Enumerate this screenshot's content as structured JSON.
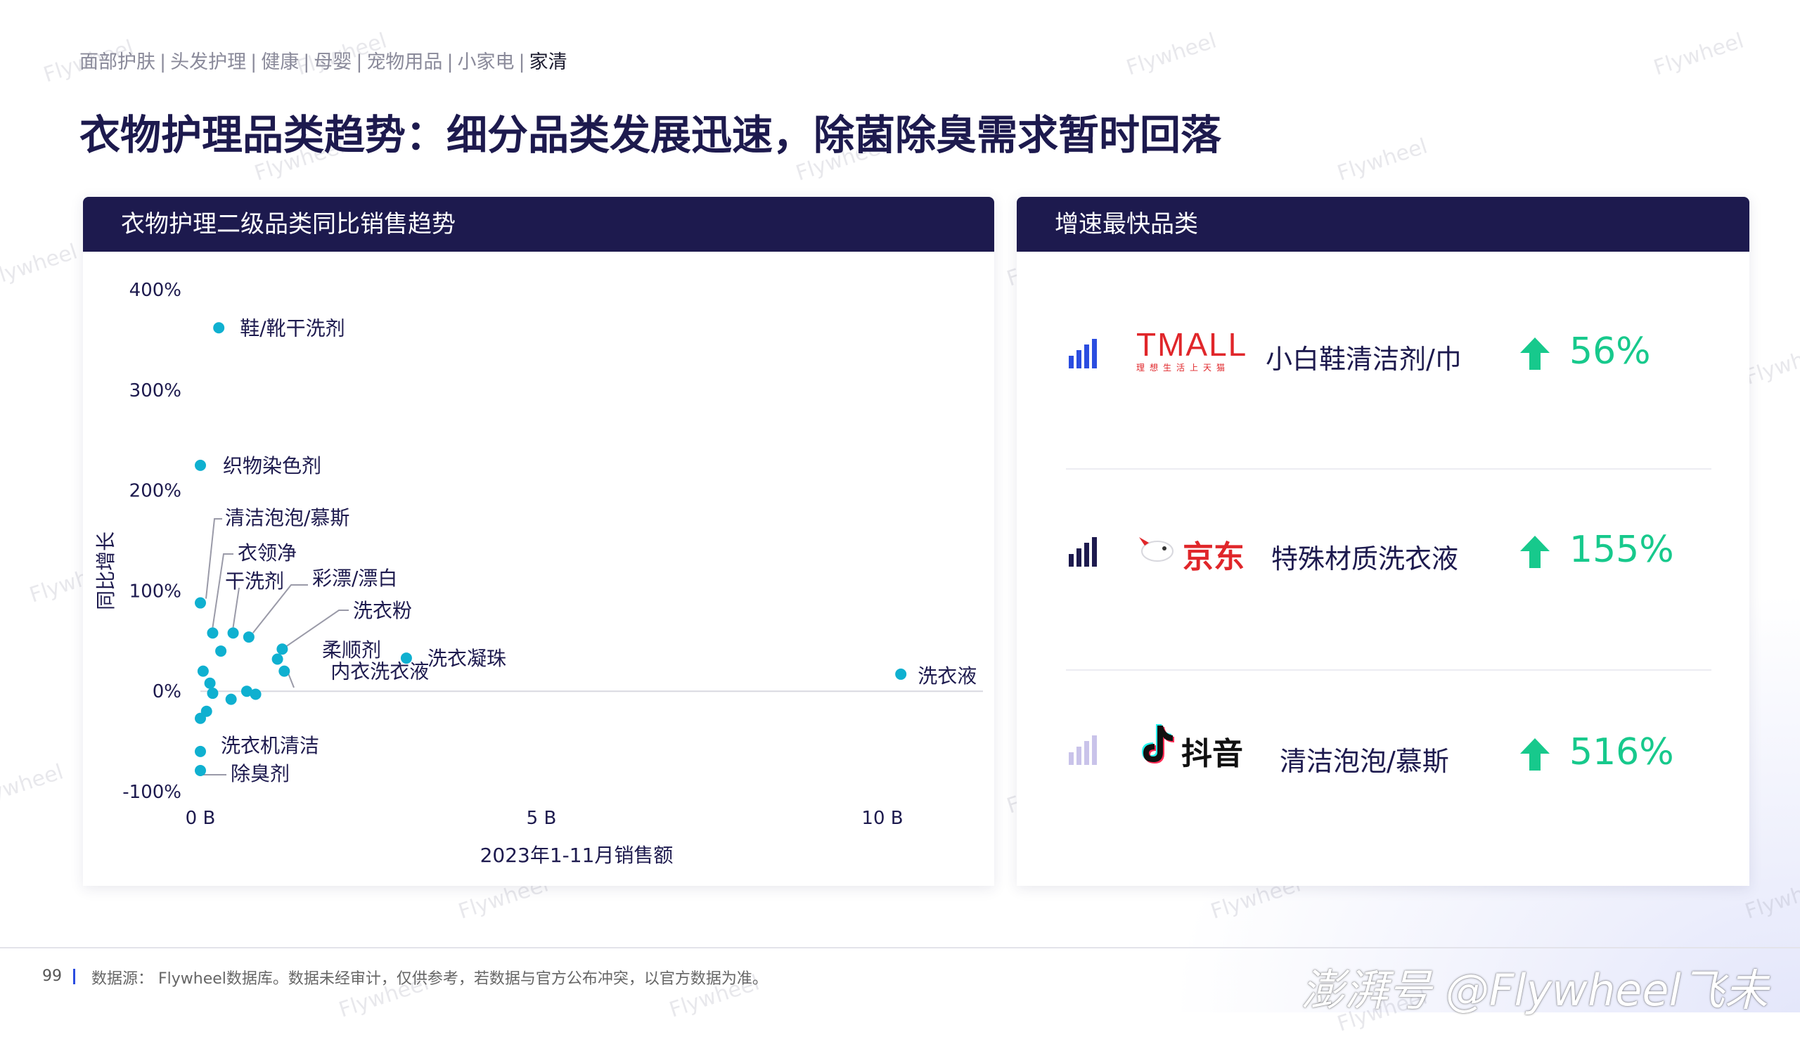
{
  "breadcrumb": {
    "items": [
      "面部护肤",
      "头发护理",
      "健康",
      "母婴",
      "宠物用品",
      "小家电",
      "家清"
    ],
    "separator": "|",
    "active_index": 6
  },
  "page_title": "衣物护理品类趋势：细分品类发展迅速，除菌除臭需求暂时回落",
  "left_panel": {
    "header": "衣物护理二级品类同比销售趋势"
  },
  "right_panel": {
    "header": "增速最快品类",
    "rows": [
      {
        "platform": "TMALL",
        "platform_sub": "理想生活上天猫",
        "category": "小白鞋清洁剂/巾",
        "growth": "56%",
        "bar_color": "#2b4de0"
      },
      {
        "platform": "京东",
        "category": "特殊材质洗衣液",
        "growth": "155%",
        "bar_color": "#1d1a4e"
      },
      {
        "platform": "抖音",
        "category": "清洁泡泡/慕斯",
        "growth": "516%",
        "bar_color": "#c9c3ea"
      }
    ]
  },
  "chart_data": {
    "type": "scatter",
    "xlabel": "2023年1-11月销售额",
    "ylabel": "同比增长",
    "x_unit": "B",
    "xlim": [
      0,
      11.3
    ],
    "ylim": [
      -100,
      400
    ],
    "x_ticks": [
      0,
      5,
      10
    ],
    "x_tick_labels": [
      "0 B",
      "5 B",
      "10 B"
    ],
    "y_ticks": [
      400,
      300,
      200,
      100,
      0,
      -100
    ],
    "y_tick_labels": [
      "400%",
      "300%",
      "200%",
      "100%",
      "0%",
      "-100%"
    ],
    "grid": false,
    "zero_line": true,
    "point_color": "#0fb0d0",
    "points": [
      {
        "label": "鞋/靴干洗剂",
        "x": 0.27,
        "y": 362
      },
      {
        "label": "织物染色剂",
        "x": 0.0,
        "y": 225
      },
      {
        "label": "清洁泡泡/慕斯",
        "x": 0.0,
        "y": 88
      },
      {
        "label": "衣领净",
        "x": 0.18,
        "y": 58
      },
      {
        "label": "干洗剂",
        "x": 0.48,
        "y": 58
      },
      {
        "label": "彩漂/漂白",
        "x": 0.71,
        "y": 54
      },
      {
        "label": "",
        "x": 0.3,
        "y": 40
      },
      {
        "label": "洗衣粉",
        "x": 1.2,
        "y": 42
      },
      {
        "label": "柔顺剂",
        "x": 1.13,
        "y": 32
      },
      {
        "label": "洗衣凝珠",
        "x": 3.02,
        "y": 33
      },
      {
        "label": "",
        "x": 0.04,
        "y": 20
      },
      {
        "label": "内衣洗衣液",
        "x": 1.23,
        "y": 20
      },
      {
        "label": "",
        "x": 0.14,
        "y": 8
      },
      {
        "label": "洗衣液",
        "x": 10.27,
        "y": 17
      },
      {
        "label": "",
        "x": 0.68,
        "y": 0
      },
      {
        "label": "",
        "x": 0.18,
        "y": -2
      },
      {
        "label": "",
        "x": 0.81,
        "y": -3
      },
      {
        "label": "",
        "x": 0.45,
        "y": -8
      },
      {
        "label": "",
        "x": 0.09,
        "y": -20
      },
      {
        "label": "",
        "x": 0.0,
        "y": -27
      },
      {
        "label": "洗衣机清洁",
        "x": 0.0,
        "y": -60
      },
      {
        "label": "除臭剂",
        "x": 0.0,
        "y": -79
      }
    ]
  },
  "footer": {
    "page_number": "99",
    "source": "数据源： Flywheel数据库。数据未经审计，仅供参考，若数据与官方公布冲突，以官方数据为准。",
    "brand": "澎湃号 @Flywheel飞未"
  },
  "watermark_text": "Flywheel"
}
